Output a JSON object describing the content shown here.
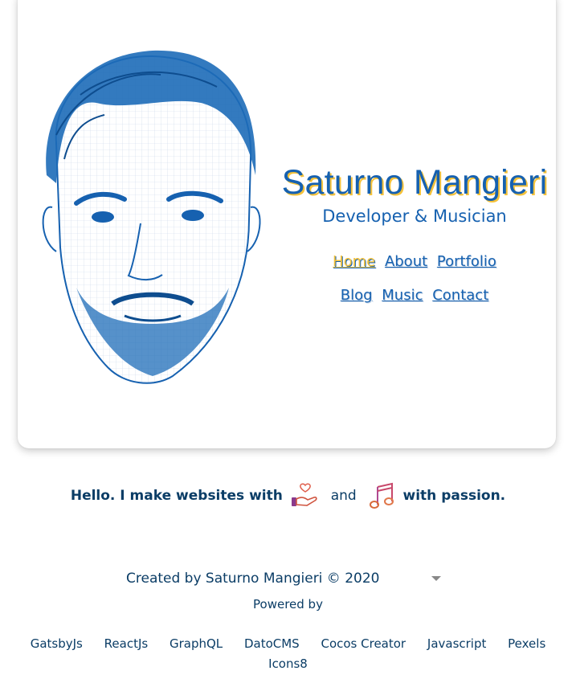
{
  "hero": {
    "name": "Saturno Mangieri",
    "subtitle": "Developer & Musician",
    "portrait_icon": "sketched-portrait-illustration"
  },
  "nav": {
    "row1": [
      {
        "label": "Home",
        "active": true
      },
      {
        "label": "About",
        "active": false
      },
      {
        "label": "Portfolio",
        "active": false
      }
    ],
    "row2": [
      {
        "label": "Blog",
        "active": false
      },
      {
        "label": "Music",
        "active": false
      },
      {
        "label": "Contact",
        "active": false
      }
    ]
  },
  "tagline": {
    "part1": "Hello. I make websites with",
    "icon1": "hand-with-heart-icon",
    "and": "and",
    "icon2": "music-note-icon",
    "part2": "with passion."
  },
  "footer": {
    "created": "Created by Saturno Mangieri © 2020",
    "dropdown_icon": "chevron-down-icon",
    "powered_by": "Powered by",
    "techs": [
      "GatsbyJs",
      "ReactJs",
      "GraphQL",
      "DatoCMS",
      "Cocos Creator",
      "Javascript",
      "Pexels",
      "Icons8"
    ]
  },
  "colors": {
    "primary": "#1661b0",
    "accent": "#f5c23a",
    "text": "#0b3d66"
  }
}
